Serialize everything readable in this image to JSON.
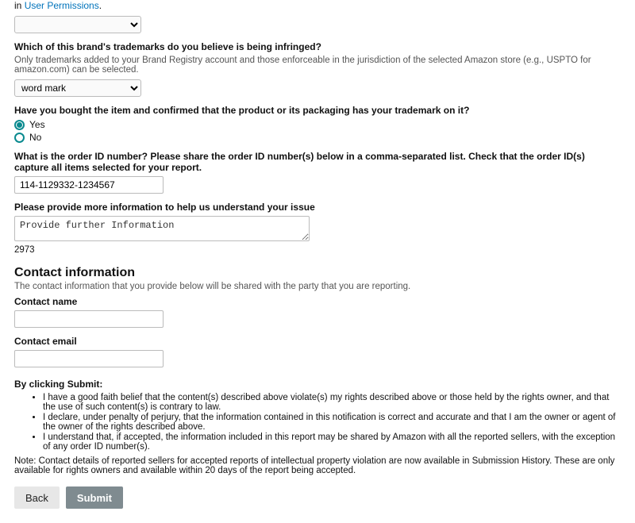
{
  "top_fragment": {
    "prefix": "in ",
    "link": "User Permissions",
    "suffix": "."
  },
  "trademark_select": {
    "question": "Which of this brand's trademarks do you believe is being infringed?",
    "helper": "Only trademarks added to your Brand Registry account and those enforceable in the jurisdiction of the selected Amazon store (e.g., USPTO for amazon.com) can be selected.",
    "selected": "word mark",
    "options": [
      "word mark"
    ]
  },
  "bought_item": {
    "question": "Have you bought the item and confirmed that the product or its packaging has your trademark on it?",
    "option_yes": "Yes",
    "option_no": "No",
    "value": "yes"
  },
  "order_id": {
    "question": "What is the order ID number? Please share the order ID number(s) below in a comma-separated list. Check that the order ID(s) capture all items selected for your report.",
    "value": "114-1129332-1234567"
  },
  "more_info": {
    "question": "Please provide more information to help us understand your issue",
    "value": "Provide further Information",
    "remaining": "2973"
  },
  "contact": {
    "heading": "Contact information",
    "subtext": "The contact information that you provide below will be shared with the party that you are reporting.",
    "name_label": "Contact name",
    "name_value": "",
    "email_label": "Contact email",
    "email_value": ""
  },
  "declaration": {
    "heading": "By clicking Submit:",
    "bullets": [
      "I have a good faith belief that the content(s) described above violate(s) my rights described above or those held by the rights owner, and that the use of such content(s) is contrary to law.",
      "I declare, under penalty of perjury, that the information contained in this notification is correct and accurate and that I am the owner or agent of the owner of the rights described above.",
      "I understand that, if accepted, the information included in this report may be shared by Amazon with all the reported sellers, with the exception of any order ID number(s)."
    ]
  },
  "note": "Note: Contact details of reported sellers for accepted reports of intellectual property violation are now available in Submission History. These are only available for rights owners and available within 20 days of the report being accepted.",
  "buttons": {
    "back": "Back",
    "submit": "Submit"
  }
}
